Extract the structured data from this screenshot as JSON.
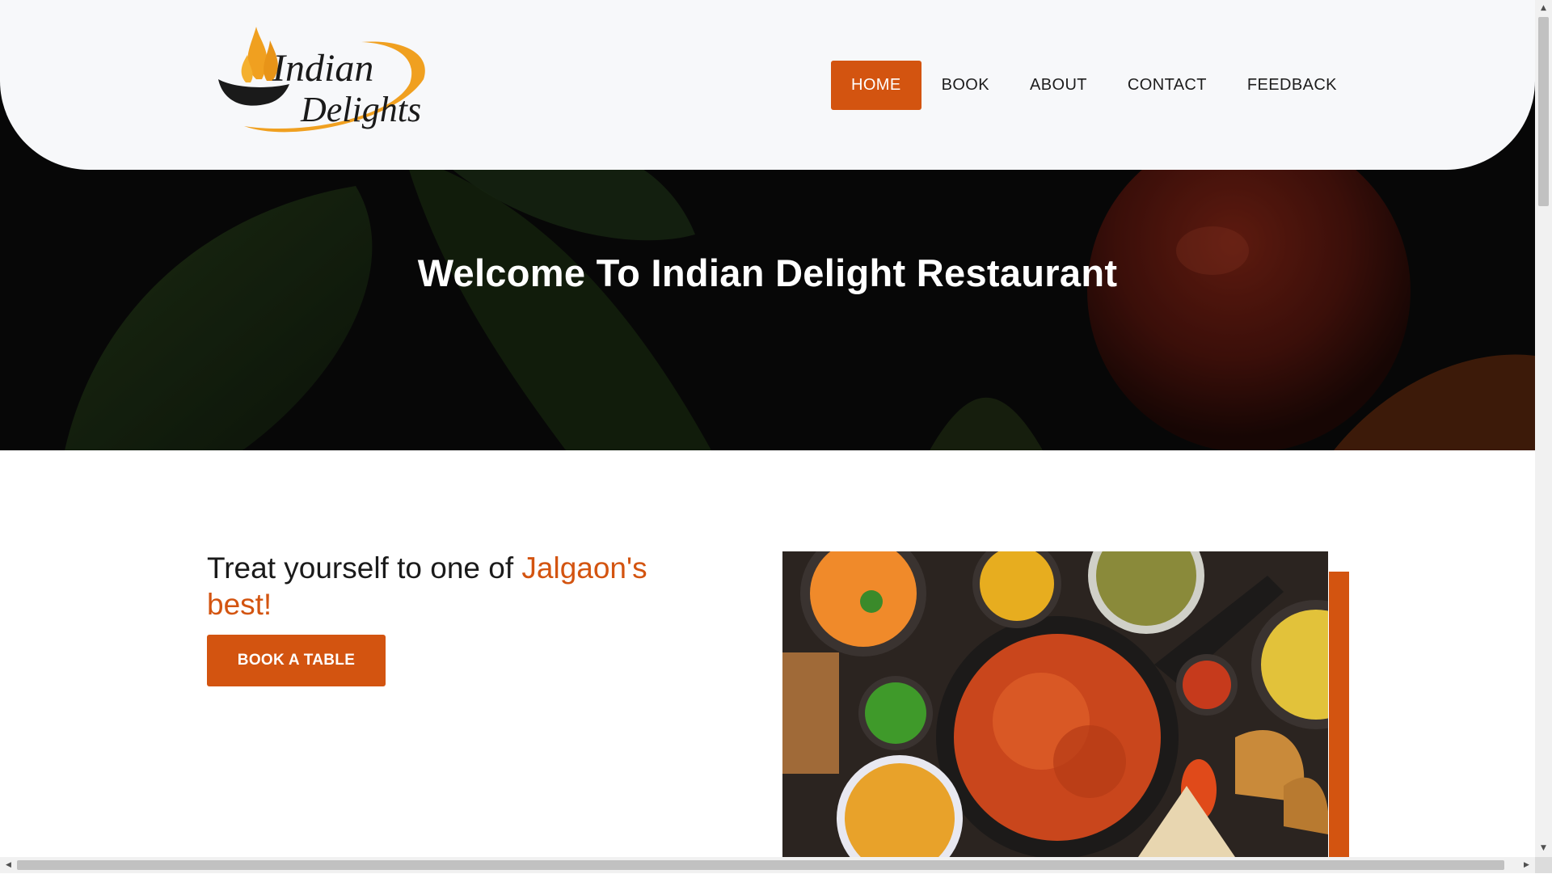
{
  "brand": {
    "logo_text_line1": "Indian",
    "logo_text_line2": "Delights",
    "colors": {
      "accent": "#d35410",
      "logo_gold": "#f0a020",
      "navbar_bg": "#f7f8fa"
    }
  },
  "nav": {
    "items": [
      {
        "label": "HOME",
        "active": true
      },
      {
        "label": "BOOK",
        "active": false
      },
      {
        "label": "ABOUT",
        "active": false
      },
      {
        "label": "CONTACT",
        "active": false
      },
      {
        "label": "FEEDBACK",
        "active": false
      }
    ]
  },
  "hero": {
    "title": "Welcome To Indian Delight Restaurant"
  },
  "intro": {
    "text_start": "Treat yourself to one of ",
    "text_accent": "Jalgaon's best!",
    "cta_label": "BOOK A TABLE"
  },
  "images": {
    "food": "indian-food-spread-photo"
  }
}
